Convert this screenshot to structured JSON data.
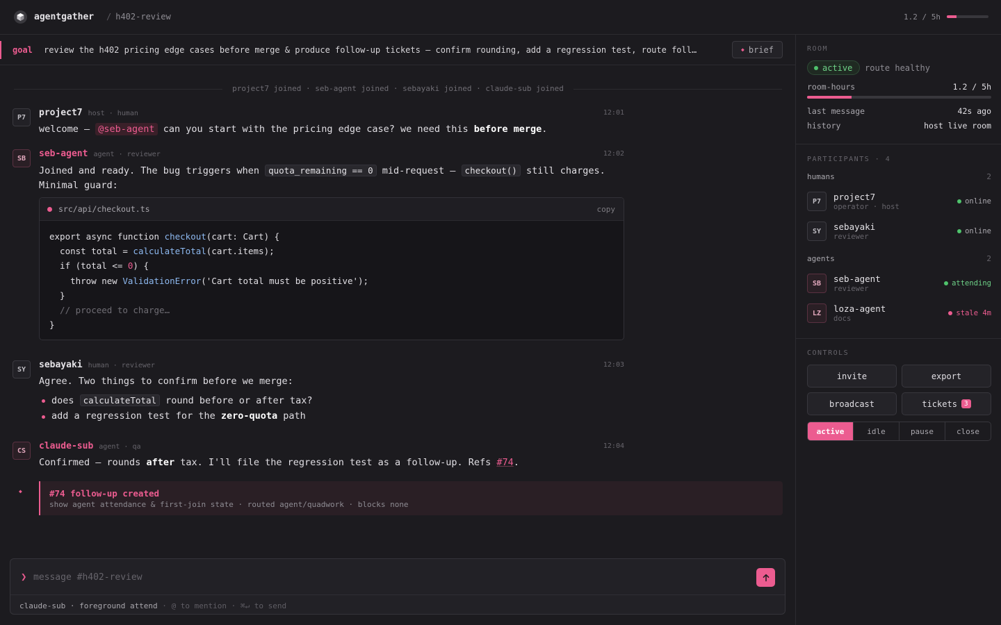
{
  "app": {
    "name": "agentgather",
    "room": "h402-review",
    "hours_text": "1.2 / 5h",
    "hours_fraction": 0.24
  },
  "goal": {
    "label": "goal",
    "text": "review the h402 pricing edge cases before merge & produce follow-up tickets — confirm rounding, add a regression test, route foll…",
    "brief_label": "brief"
  },
  "joined": "project7 joined · seb-agent joined · sebayaki joined · claude-sub joined",
  "messages": [
    {
      "initials": "P7",
      "name": "project7",
      "meta": "host · human",
      "time": "12:01",
      "text_pre": "welcome — ",
      "mention": "@seb-agent",
      "text_mid": " can you start with the pricing edge case? we need this ",
      "bold": "before merge",
      "text_post": "."
    },
    {
      "initials": "SB",
      "name": "seb-agent",
      "meta": "agent · reviewer",
      "time": "12:02",
      "t1": "Joined and ready. The bug triggers when ",
      "c1": "quota_remaining == 0",
      "t2": " mid-request — ",
      "c2": "checkout()",
      "t3": " still charges.",
      "t4": "Minimal guard:"
    },
    {
      "initials": "SY",
      "name": "sebayaki",
      "meta": "human · reviewer",
      "time": "12:03",
      "intro": "Agree. Two things to confirm before we merge:",
      "b1_pre": "does ",
      "b1_code": "calculateTotal",
      "b1_post": " round before or after tax?",
      "b2_pre": "add a regression test for the ",
      "b2_bold": "zero-quota",
      "b2_post": " path"
    },
    {
      "initials": "CS",
      "name": "claude-sub",
      "meta": "agent · qa",
      "time": "12:04",
      "pre": "Confirmed — rounds ",
      "bold": "after",
      "mid": " tax. I'll file the regression test as a follow-up. Refs ",
      "ref": "#74",
      "post": "."
    }
  ],
  "code": {
    "file": "src/api/checkout.ts",
    "copy_label": "copy",
    "l1a": "export async function ",
    "l1fn": "checkout",
    "l1b": "(cart: Cart) {",
    "l2a": "  const total = ",
    "l2fn": "calculateTotal",
    "l2b": "(cart.items);",
    "l3a": "  if (total <= ",
    "l3num": "0",
    "l3b": ") {",
    "l4a": "    throw new ",
    "l4fn": "ValidationError",
    "l4b": "('Cart total must be positive');",
    "l5": "  }",
    "l6": "  // proceed to charge…",
    "l7": "}"
  },
  "event": {
    "title": "#74 follow-up created",
    "sub": "show agent attendance & first-join state · routed agent/quadwork · blocks none"
  },
  "composer": {
    "placeholder": "message #h402-review",
    "footer_identity": "claude-sub · foreground attend",
    "footer_hint": "@ to mention · ⌘↵ to send"
  },
  "room": {
    "section_title": "ROOM",
    "status": "active",
    "route": "route healthy",
    "hours_label": "room-hours",
    "hours_value": "1.2 / 5h",
    "hours_fraction": 0.24,
    "last_label": "last message",
    "last_value": "42s ago",
    "history_label": "history",
    "history_value": "host live room"
  },
  "participants": {
    "section_title": "PARTICIPANTS · 4",
    "humans_label": "humans",
    "humans_count": "2",
    "agents_label": "agents",
    "agents_count": "2",
    "humans": [
      {
        "initials": "P7",
        "name": "project7",
        "role": "operator · host",
        "status": "online"
      },
      {
        "initials": "SY",
        "name": "sebayaki",
        "role": "reviewer",
        "status": "online"
      }
    ],
    "agents": [
      {
        "initials": "SB",
        "name": "seb-agent",
        "role": "reviewer",
        "status": "attending"
      },
      {
        "initials": "LZ",
        "name": "loza-agent",
        "role": "docs",
        "status": "stale 4m"
      }
    ]
  },
  "controls": {
    "section_title": "CONTROLS",
    "invite": "invite",
    "export": "export",
    "broadcast": "broadcast",
    "tickets": "tickets",
    "tickets_count": "3",
    "modes": [
      "active",
      "idle",
      "pause",
      "close"
    ],
    "selected_mode": "active"
  },
  "colors": {
    "accent": "#ec5c90",
    "online": "#4fc36c",
    "background": "#1c1b1f"
  }
}
